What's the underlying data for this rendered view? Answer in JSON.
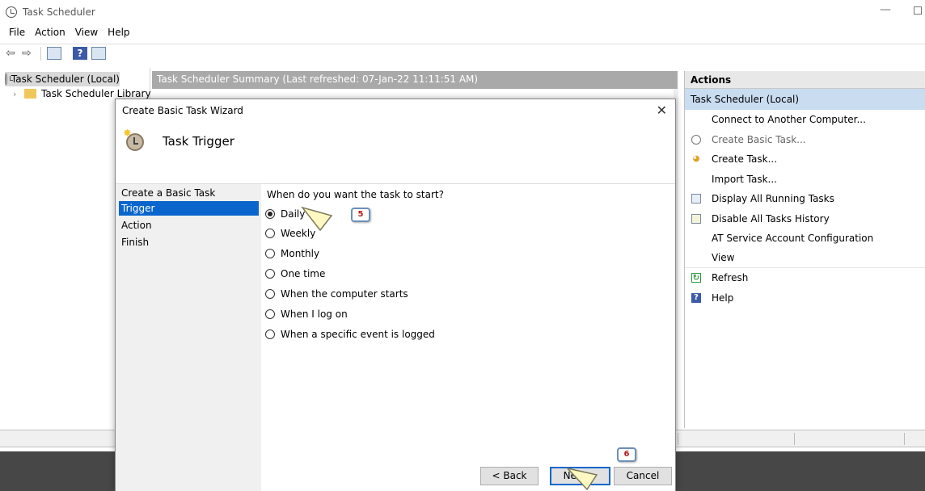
{
  "window": {
    "title": "Task Scheduler"
  },
  "menu": [
    "File",
    "Action",
    "View",
    "Help"
  ],
  "tree": {
    "root": "Task Scheduler (Local)",
    "library": "Task Scheduler Library"
  },
  "summary": {
    "header": "Task Scheduler Summary (Last refreshed: 07-Jan-22 11:11:51 AM)"
  },
  "actions": {
    "header": "Actions",
    "section": "Task Scheduler (Local)",
    "items": [
      {
        "label": "Connect to Another Computer...",
        "icon": "none"
      },
      {
        "label": "Create Basic Task...",
        "icon": "create-basic-task-icon"
      },
      {
        "label": "Create Task...",
        "icon": "create-task-icon"
      },
      {
        "label": "Import Task...",
        "icon": "none"
      },
      {
        "label": "Display All Running Tasks",
        "icon": "running-tasks-icon"
      },
      {
        "label": "Disable All Tasks History",
        "icon": "history-icon"
      },
      {
        "label": "AT Service Account Configuration",
        "icon": "none"
      },
      {
        "label": "View",
        "icon": "none"
      },
      {
        "label": "Refresh",
        "icon": "refresh-icon"
      },
      {
        "label": "Help",
        "icon": "help-icon"
      }
    ]
  },
  "wizard": {
    "title": "Create Basic Task Wizard",
    "heading": "Task Trigger",
    "steps": [
      "Create a Basic Task",
      "Trigger",
      "Action",
      "Finish"
    ],
    "selected_step": "Trigger",
    "question": "When do you want the task to start?",
    "options": [
      "Daily",
      "Weekly",
      "Monthly",
      "One time",
      "When the computer starts",
      "When I log on",
      "When a specific event is logged"
    ],
    "selected_option": "Daily",
    "buttons": {
      "back": "< Back",
      "next": "Next >",
      "cancel": "Cancel"
    }
  },
  "callouts": {
    "first": "5",
    "second": "6"
  },
  "colors": {
    "selection_blue": "#0a66cc",
    "actions_section": "#c9dcf0",
    "callout_number": "#b31b1b"
  }
}
